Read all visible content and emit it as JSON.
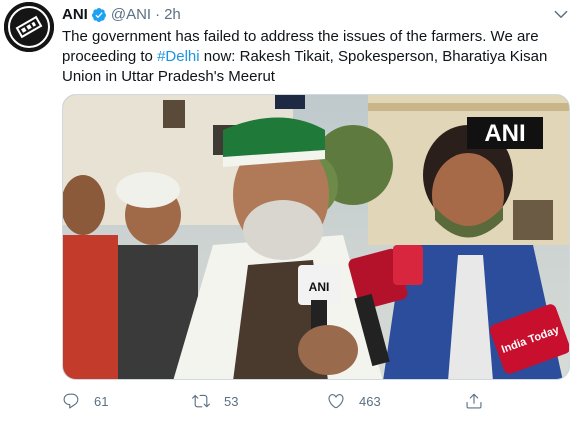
{
  "tweet": {
    "display_name": "ANI",
    "handle": "@ANI",
    "separator": "·",
    "time": "2h",
    "text_before": "The government has failed to address the issues of the farmers. We are proceeding to ",
    "hashtag": "#Delhi",
    "text_after": " now: Rakesh Tikait, Spokesperson, Bharatiya Kisan Union in Uttar Pradesh's Meerut",
    "media_watermark": "ANI",
    "mic_labels": [
      "ANI",
      "India Today"
    ],
    "stats": {
      "replies": "61",
      "retweets": "53",
      "likes": "463"
    }
  },
  "icons": {
    "avatar": "ani-logo-avatar",
    "verified": "verified-badge-icon",
    "more": "more-options-icon",
    "reply": "reply-icon",
    "retweet": "retweet-icon",
    "like": "heart-icon",
    "share": "share-icon"
  },
  "colors": {
    "verified": "#1da1f2",
    "hashtag": "#1b95e0",
    "secondary_text": "#5b7083",
    "primary_text": "#0f1419"
  }
}
